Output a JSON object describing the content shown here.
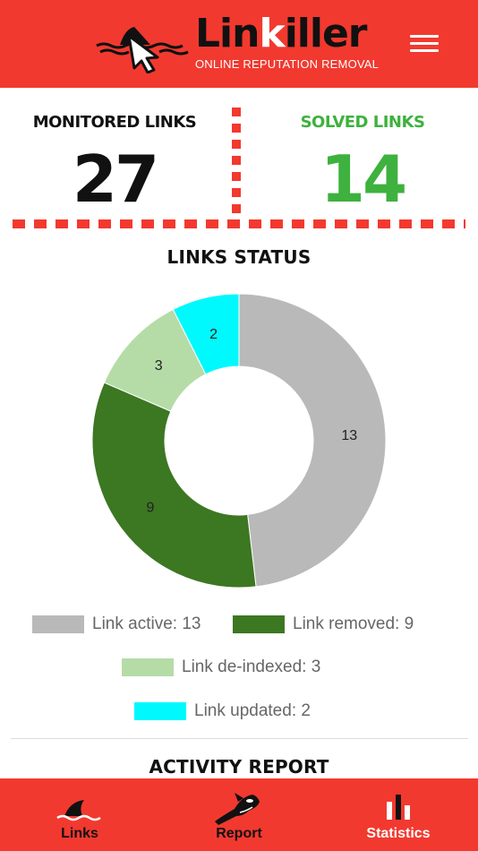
{
  "header": {
    "brand_prefix": "Lin",
    "brand_highlight": "k",
    "brand_suffix": "iller",
    "tagline": "ONLINE REPUTATION REMOVAL",
    "menu_icon": "hamburger-menu-icon"
  },
  "stats": {
    "monitored_label": "MONITORED LINKS",
    "monitored_value": "27",
    "solved_label": "SOLVED LINKS",
    "solved_value": "14",
    "solved_color": "#3eb13e"
  },
  "links_status": {
    "title": "LINKS STATUS"
  },
  "chart_data": {
    "type": "pie",
    "variant": "donut",
    "categories": [
      "Link active",
      "Link removed",
      "Link de-indexed",
      "Link updated"
    ],
    "values": [
      13,
      9,
      3,
      2
    ],
    "colors": [
      "#b9b9b9",
      "#3c7722",
      "#b5dca7",
      "#00f9fc"
    ],
    "legend": [
      {
        "label": "Link active: 13",
        "color": "#b9b9b9"
      },
      {
        "label": "Link removed: 9",
        "color": "#3c7722"
      },
      {
        "label": "Link de-indexed: 3",
        "color": "#b5dca7"
      },
      {
        "label": "Link updated: 2",
        "color": "#00f9fc"
      }
    ]
  },
  "activity_report": {
    "title": "ACTIVITY REPORT"
  },
  "tabbar": {
    "tabs": [
      {
        "label": "Links",
        "icon": "shark-fin-icon",
        "color": "#111111"
      },
      {
        "label": "Report",
        "icon": "orca-icon",
        "color": "#111111"
      },
      {
        "label": "Statistics",
        "icon": "bar-chart-icon",
        "color": "#ffffff",
        "active": true
      }
    ]
  },
  "colors": {
    "accent": "#f2392f"
  }
}
